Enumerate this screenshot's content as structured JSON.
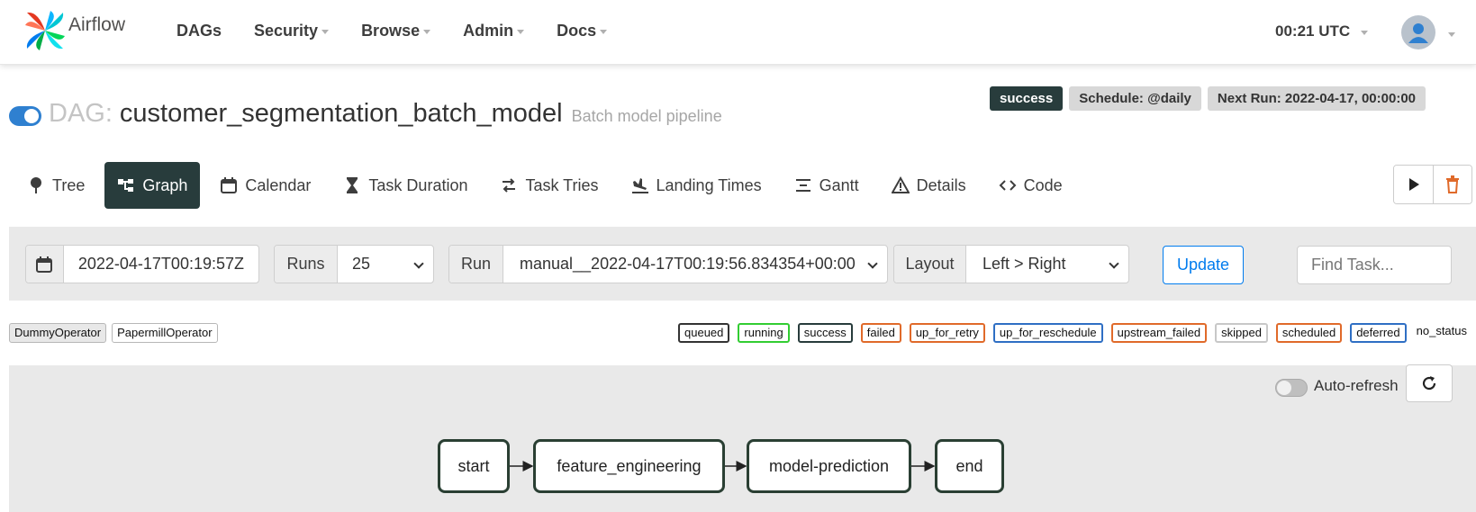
{
  "nav": {
    "brand": "Airflow",
    "items": [
      {
        "label": "DAGs",
        "dropdown": false
      },
      {
        "label": "Security",
        "dropdown": true
      },
      {
        "label": "Browse",
        "dropdown": true
      },
      {
        "label": "Admin",
        "dropdown": true
      },
      {
        "label": "Docs",
        "dropdown": true
      }
    ],
    "clock": "00:21 UTC"
  },
  "dag": {
    "prefix": "DAG:",
    "id": "customer_segmentation_batch_model",
    "description": "Batch model pipeline",
    "paused": false,
    "status_badge": "success",
    "schedule_badge": "Schedule: @daily",
    "next_run_badge": "Next Run: 2022-04-17, 00:00:00"
  },
  "tabs": {
    "active": "Graph",
    "items": [
      "Tree",
      "Graph",
      "Calendar",
      "Task Duration",
      "Task Tries",
      "Landing Times",
      "Gantt",
      "Details",
      "Code"
    ]
  },
  "filters": {
    "base_date": "2022-04-17T00:19:57Z",
    "runs_label": "Runs",
    "runs_value": "25",
    "run_label": "Run",
    "run_value": "manual__2022-04-17T00:19:56.834354+00:00",
    "layout_label": "Layout",
    "layout_value": "Left > Right",
    "update_label": "Update",
    "find_task_placeholder": "Find Task..."
  },
  "operators": [
    "DummyOperator",
    "PapermillOperator"
  ],
  "states": [
    {
      "label": "queued",
      "color": "#333333"
    },
    {
      "label": "running",
      "color": "#32cd32"
    },
    {
      "label": "success",
      "color": "#283c3c"
    },
    {
      "label": "failed",
      "color": "#e06a2a"
    },
    {
      "label": "up_for_retry",
      "color": "#e06a2a"
    },
    {
      "label": "up_for_reschedule",
      "color": "#2f6fc4"
    },
    {
      "label": "upstream_failed",
      "color": "#e06a2a"
    },
    {
      "label": "skipped",
      "color": "#c8c8c8"
    },
    {
      "label": "scheduled",
      "color": "#e06a2a"
    },
    {
      "label": "deferred",
      "color": "#2f6fc4"
    },
    {
      "label": "no_status",
      "color": null
    }
  ],
  "graph": {
    "auto_refresh_label": "Auto-refresh",
    "auto_refresh_on": false,
    "nodes": [
      "start",
      "feature_engineering",
      "model-prediction",
      "end"
    ],
    "node_border_color": "#2a3f33"
  },
  "colors": {
    "accent": "#017cee",
    "nav_dark": "#283c3c",
    "delete": "#e06a2a"
  }
}
